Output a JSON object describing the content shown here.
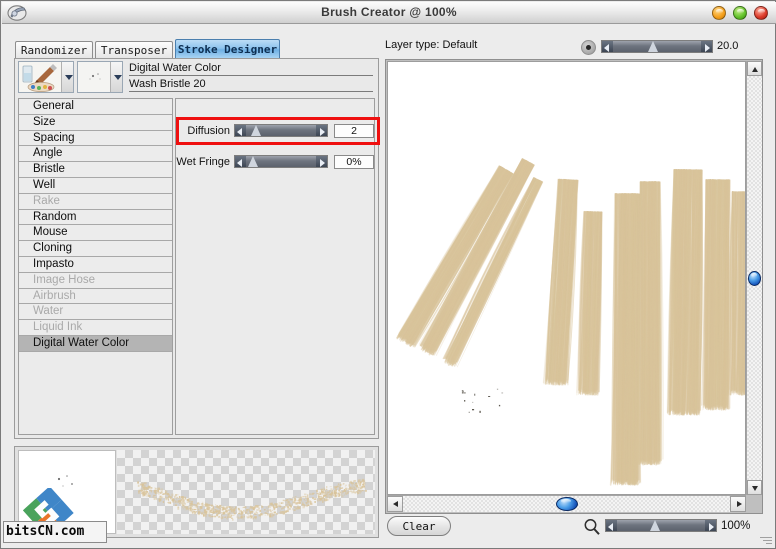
{
  "window": {
    "title": "Brush Creator @ 100%",
    "app_icon": "brush-app-icon",
    "buttons": {
      "minimize": "minimize",
      "maximize": "maximize",
      "close": "close"
    }
  },
  "tabs": [
    {
      "label": "Randomizer",
      "active": false
    },
    {
      "label": "Transposer",
      "active": false
    },
    {
      "label": "Stroke Designer",
      "active": true
    }
  ],
  "brush_selector": {
    "category_name": "Digital Water Color",
    "variant_name": "Wash Bristle 20",
    "category_icon": "brush-palette-icon",
    "variant_icon": "dab-preview-icon",
    "dropdown_arrow": "chevron-down-icon"
  },
  "control_list": [
    {
      "label": "General",
      "enabled": true,
      "selected": false
    },
    {
      "label": "Size",
      "enabled": true,
      "selected": false
    },
    {
      "label": "Spacing",
      "enabled": true,
      "selected": false
    },
    {
      "label": "Angle",
      "enabled": true,
      "selected": false
    },
    {
      "label": "Bristle",
      "enabled": true,
      "selected": false
    },
    {
      "label": "Well",
      "enabled": true,
      "selected": false
    },
    {
      "label": "Rake",
      "enabled": false,
      "selected": false
    },
    {
      "label": "Random",
      "enabled": true,
      "selected": false
    },
    {
      "label": "Mouse",
      "enabled": true,
      "selected": false
    },
    {
      "label": "Cloning",
      "enabled": true,
      "selected": false
    },
    {
      "label": "Impasto",
      "enabled": true,
      "selected": false
    },
    {
      "label": "Image Hose",
      "enabled": false,
      "selected": false
    },
    {
      "label": "Airbrush",
      "enabled": false,
      "selected": false
    },
    {
      "label": "Water",
      "enabled": false,
      "selected": false
    },
    {
      "label": "Liquid Ink",
      "enabled": false,
      "selected": false
    },
    {
      "label": "Digital Water Color",
      "enabled": true,
      "selected": true
    }
  ],
  "options": {
    "diffusion": {
      "label": "Diffusion",
      "value": "2",
      "slider_percent": 8,
      "highlighted": true
    },
    "wet_fringe": {
      "label": "Wet Fringe",
      "value": "0%",
      "slider_percent": 3,
      "highlighted": false
    },
    "highlight_color": "#ef1010"
  },
  "canvas_header": {
    "layer_type_label": "Layer type: Default",
    "opacity_icon": "dab-dot-icon",
    "opacity_value": "20.0",
    "opacity_slider_percent": 45
  },
  "canvas": {
    "stroke_color": "#d9c49b",
    "background": "#ffffff",
    "vertical_scrollbar": {
      "thumb_percent": 50,
      "up_arrow": "scroll-up-arrow-icon",
      "down_arrow": "scroll-down-arrow-icon"
    },
    "horizontal_scrollbar": {
      "thumb_percent": 50,
      "left_arrow": "scroll-left-arrow-icon",
      "right_arrow": "scroll-right-arrow-icon"
    }
  },
  "footer": {
    "clear_label": "Clear",
    "zoom_icon": "magnifier-icon",
    "zoom_value": "100%",
    "zoom_slider_percent": 42
  },
  "preview": {
    "swatch_background": "#ffffff",
    "checker_label": "transparency-checker"
  },
  "watermark": {
    "text": "bitsCN.com",
    "logo": "bitscn-logo"
  }
}
